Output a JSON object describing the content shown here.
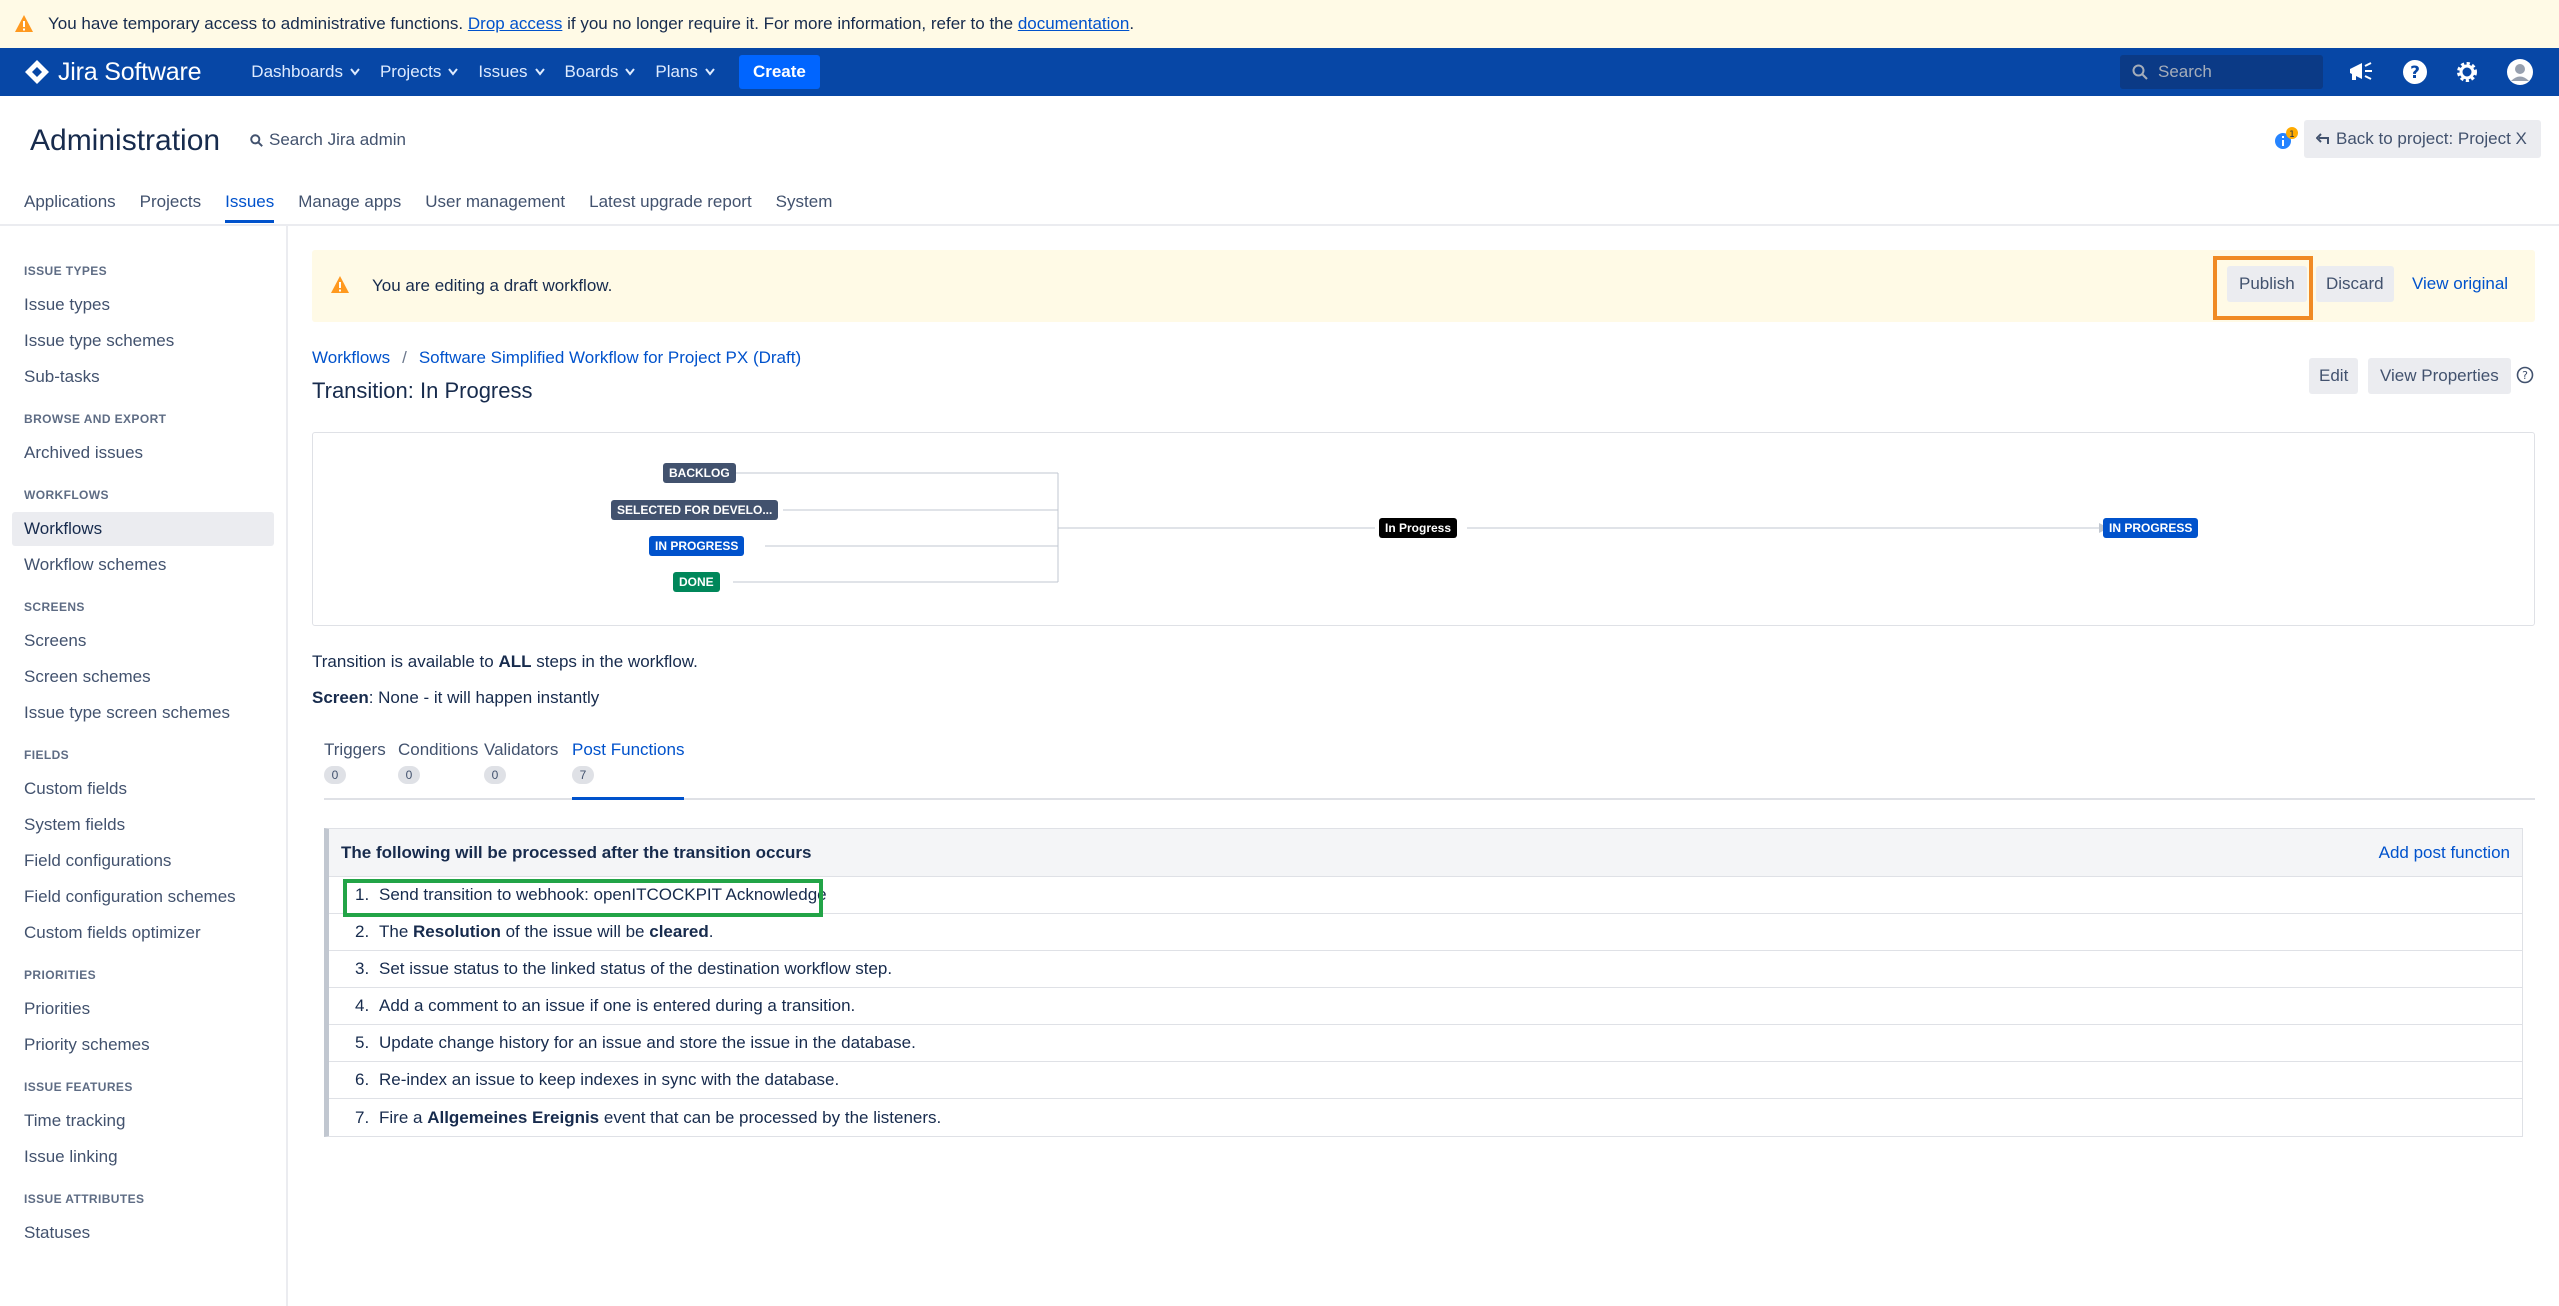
{
  "banner": {
    "text_before": "You have temporary access to administrative functions.",
    "drop_link": "Drop access",
    "text_middle": "if you no longer require it. For more information, refer to the",
    "doc_link": "documentation",
    "text_end": "."
  },
  "topnav": {
    "logo_text": "Jira Software",
    "items": [
      "Dashboards",
      "Projects",
      "Issues",
      "Boards",
      "Plans"
    ],
    "create_label": "Create",
    "search_placeholder": "Search",
    "icons": [
      "megaphone-icon",
      "help-icon",
      "gear-icon",
      "avatar-icon"
    ]
  },
  "admin": {
    "title": "Administration",
    "search_label": "Search Jira admin",
    "tabs": [
      "Applications",
      "Projects",
      "Issues",
      "Manage apps",
      "User management",
      "Latest upgrade report",
      "System"
    ],
    "active_tab": "Issues",
    "back_button": "Back to project: Project X",
    "notification_count": "1"
  },
  "sidebar": {
    "groups": [
      {
        "heading": "ISSUE TYPES",
        "items": [
          "Issue types",
          "Issue type schemes",
          "Sub-tasks"
        ]
      },
      {
        "heading": "BROWSE AND EXPORT",
        "items": [
          "Archived issues"
        ]
      },
      {
        "heading": "WORKFLOWS",
        "items": [
          "Workflows",
          "Workflow schemes"
        ]
      },
      {
        "heading": "SCREENS",
        "items": [
          "Screens",
          "Screen schemes",
          "Issue type screen schemes"
        ]
      },
      {
        "heading": "FIELDS",
        "items": [
          "Custom fields",
          "System fields",
          "Field configurations",
          "Field configuration schemes",
          "Custom fields optimizer"
        ]
      },
      {
        "heading": "PRIORITIES",
        "items": [
          "Priorities",
          "Priority schemes"
        ]
      },
      {
        "heading": "ISSUE FEATURES",
        "items": [
          "Time tracking",
          "Issue linking"
        ]
      },
      {
        "heading": "ISSUE ATTRIBUTES",
        "items": [
          "Statuses"
        ]
      }
    ],
    "active_item": "Workflows"
  },
  "draft": {
    "message": "You are editing a draft workflow.",
    "publish_label": "Publish",
    "discard_label": "Discard",
    "view_original_label": "View original"
  },
  "breadcrumb": {
    "root": "Workflows",
    "separator": "/",
    "current": "Software Simplified Workflow for Project PX (Draft)"
  },
  "page": {
    "title": "Transition: In Progress",
    "edit_label": "Edit",
    "properties_label": "View Properties"
  },
  "diagram": {
    "sources": [
      "BACKLOG",
      "SELECTED FOR DEVELO...",
      "IN PROGRESS",
      "DONE"
    ],
    "transition": "In Progress",
    "target": "IN PROGRESS"
  },
  "transition_info": {
    "avail_before": "Transition is available to",
    "avail_bold": "ALL",
    "avail_after": "steps in the workflow.",
    "screen_label": "Screen",
    "screen_value": ": None - it will happen instantly"
  },
  "panel_tabs": [
    {
      "label": "Triggers",
      "count": "0"
    },
    {
      "label": "Conditions",
      "count": "0"
    },
    {
      "label": "Validators",
      "count": "0"
    },
    {
      "label": "Post Functions",
      "count": "7"
    }
  ],
  "post_functions": {
    "heading": "The following will be processed after the transition occurs",
    "add_label": "Add post function",
    "rows": [
      {
        "num": "1.",
        "pre": "Send transition to webhook: openITCOCKPIT Acknowledge",
        "b1": "",
        "mid": "",
        "b2": "",
        "post": ""
      },
      {
        "num": "2.",
        "pre": "The ",
        "b1": "Resolution",
        "mid": " of the issue will be ",
        "b2": "cleared",
        "post": "."
      },
      {
        "num": "3.",
        "pre": "Set issue status to the linked status of the destination workflow step.",
        "b1": "",
        "mid": "",
        "b2": "",
        "post": ""
      },
      {
        "num": "4.",
        "pre": "Add a comment to an issue if one is entered during a transition.",
        "b1": "",
        "mid": "",
        "b2": "",
        "post": ""
      },
      {
        "num": "5.",
        "pre": "Update change history for an issue and store the issue in the database.",
        "b1": "",
        "mid": "",
        "b2": "",
        "post": ""
      },
      {
        "num": "6.",
        "pre": "Re-index an issue to keep indexes in sync with the database.",
        "b1": "",
        "mid": "",
        "b2": "",
        "post": ""
      },
      {
        "num": "7.",
        "pre": "Fire a ",
        "b1": "Allgemeines Ereignis",
        "mid": " event that can be processed by the listeners.",
        "b2": "",
        "post": ""
      }
    ]
  },
  "colors": {
    "nav_bg": "#0747a6",
    "banner_bg": "#fffae6",
    "link": "#0052cc",
    "publish_highlight": "#f08a24",
    "row_highlight": "#22a447"
  }
}
